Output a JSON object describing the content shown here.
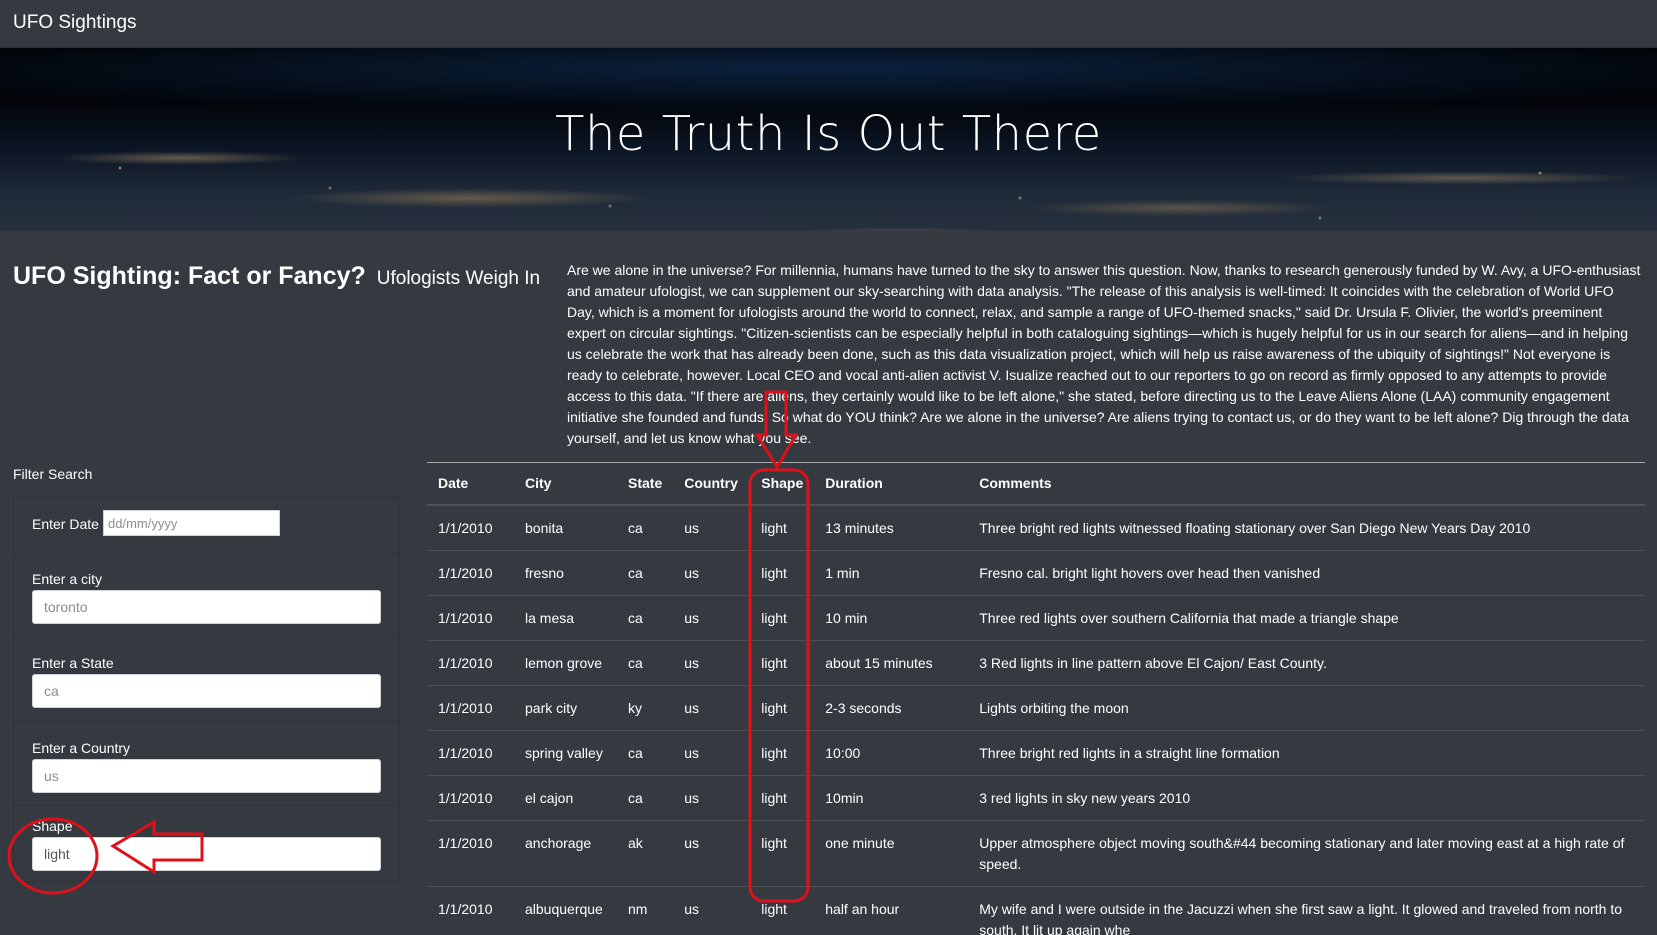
{
  "navbar": {
    "brand": "UFO Sightings"
  },
  "hero": {
    "title": "The Truth Is Out There"
  },
  "headline": {
    "main": "UFO Sighting: Fact or Fancy?",
    "sub": "Ufologists Weigh In"
  },
  "article": {
    "text": "Are we alone in the universe? For millennia, humans have turned to the sky to answer this question. Now, thanks to research generously funded by W. Avy, a UFO-enthusiast and amateur ufologist, we can supplement our sky-searching with data analysis. \"The release of this analysis is well-timed: It coincides with the celebration of World UFO Day, which is a moment for ufologists around the world to connect, relax, and sample a range of UFO-themed snacks,\" said Dr. Ursula F. Olivier, the world's preeminent expert on circular sightings. \"Citizen-scientists can be especially helpful in both cataloguing sightings—which is hugely helpful for us in our search for aliens—and in helping us celebrate the work that has already been done, such as this data visualization project, which will help us raise awareness of the ubiquity of sightings!\" Not everyone is ready to celebrate, however. Local CEO and vocal anti-alien activist V. Isualize reached out to our reporters to go on record as firmly opposed to any attempts to provide access to this data. \"If there are aliens, they certainly would like to be left alone,\" she stated, before directing us to the Leave Aliens Alone (LAA) community engagement initiative she founded and funds. So what do YOU think? Are we alone in the universe? Are aliens trying to contact us, or do they want to be left alone? Dig through the data yourself, and let us know what you see."
  },
  "filters": {
    "title": "Filter Search",
    "date": {
      "label": "Enter Date",
      "placeholder": "dd/mm/yyyy"
    },
    "city": {
      "label": "Enter a city",
      "placeholder": "toronto"
    },
    "state": {
      "label": "Enter a State",
      "placeholder": "ca"
    },
    "country": {
      "label": "Enter a Country",
      "placeholder": "us"
    },
    "shape": {
      "label": "Shape",
      "value": "light"
    }
  },
  "table": {
    "headers": [
      "Date",
      "City",
      "State",
      "Country",
      "Shape",
      "Duration",
      "Comments"
    ],
    "rows": [
      [
        "1/1/2010",
        "bonita",
        "ca",
        "us",
        "light",
        "13 minutes",
        "Three bright red lights witnessed floating stationary over San Diego New Years Day 2010"
      ],
      [
        "1/1/2010",
        "fresno",
        "ca",
        "us",
        "light",
        "1 min",
        "Fresno cal. bright light hovers over head then vanished"
      ],
      [
        "1/1/2010",
        "la mesa",
        "ca",
        "us",
        "light",
        "10 min",
        "Three red lights over southern California that made a triangle shape"
      ],
      [
        "1/1/2010",
        "lemon grove",
        "ca",
        "us",
        "light",
        "about 15 minutes",
        "3 Red lights in line pattern above El Cajon/ East County."
      ],
      [
        "1/1/2010",
        "park city",
        "ky",
        "us",
        "light",
        "2-3 seconds",
        "Lights orbiting the moon"
      ],
      [
        "1/1/2010",
        "spring valley",
        "ca",
        "us",
        "light",
        "10:00",
        "Three bright red lights in a straight line formation"
      ],
      [
        "1/1/2010",
        "el cajon",
        "ca",
        "us",
        "light",
        "10min",
        "3 red lights in sky new years 2010"
      ],
      [
        "1/1/2010",
        "anchorage",
        "ak",
        "us",
        "light",
        "one minute",
        "Upper atmosphere object moving south&#44 becoming stationary and later moving east at a high rate of speed."
      ],
      [
        "1/1/2010",
        "albuquerque",
        "nm",
        "us",
        "light",
        "half an hour",
        "My wife and I were outside in the Jacuzzi when she first saw a light. It glowed and traveled from north to south. It lit up again whe"
      ]
    ]
  },
  "annotation": {
    "color": "#e0101a"
  }
}
